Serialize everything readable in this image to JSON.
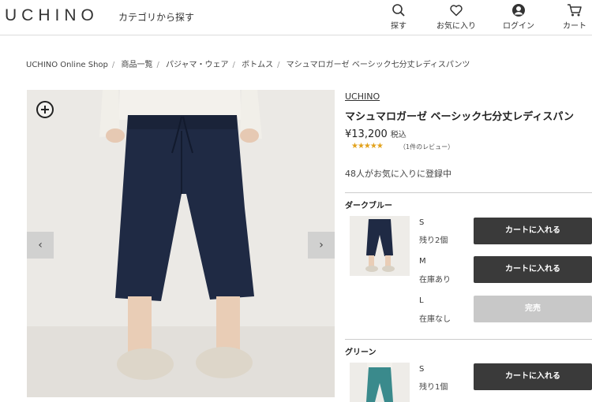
{
  "header": {
    "logo": "UCHINO",
    "category_link": "カテゴリから探す",
    "nav": {
      "search_label": "探す",
      "favorites_label": "お気に入り",
      "login_label": "ログイン",
      "cart_label": "カート"
    }
  },
  "breadcrumb": [
    "UCHINO Online Shop",
    "商品一覧",
    "パジャマ・ウェア",
    "ボトムス",
    "マシュマロガーゼ ベーシック七分丈レディスパンツ"
  ],
  "product": {
    "brand": "UCHINO",
    "title": "マシュマロガーゼ ベーシック七分丈レディスパン",
    "price": "¥13,200",
    "tax_label": "税込",
    "rating_stars": "★★★★★",
    "rating_value": 5,
    "review_count": "（1件のレビュー）",
    "favorites": "48人がお気に入りに登録中"
  },
  "gallery": {
    "prev_glyph": "‹",
    "next_glyph": "›"
  },
  "colors": [
    {
      "name": "ダークブルー",
      "hex": "#1f2a44",
      "sizes": [
        {
          "size": "S",
          "stock": "残り2個",
          "button": "カートに入れる",
          "available": true
        },
        {
          "size": "M",
          "stock": "在庫あり",
          "button": "カートに入れる",
          "available": true
        },
        {
          "size": "L",
          "stock": "在庫なし",
          "button": "完売",
          "available": false
        }
      ]
    },
    {
      "name": "グリーン",
      "hex": "#3a8a8c",
      "sizes": [
        {
          "size": "S",
          "stock": "残り1個",
          "button": "カートに入れる",
          "available": true
        }
      ]
    }
  ]
}
